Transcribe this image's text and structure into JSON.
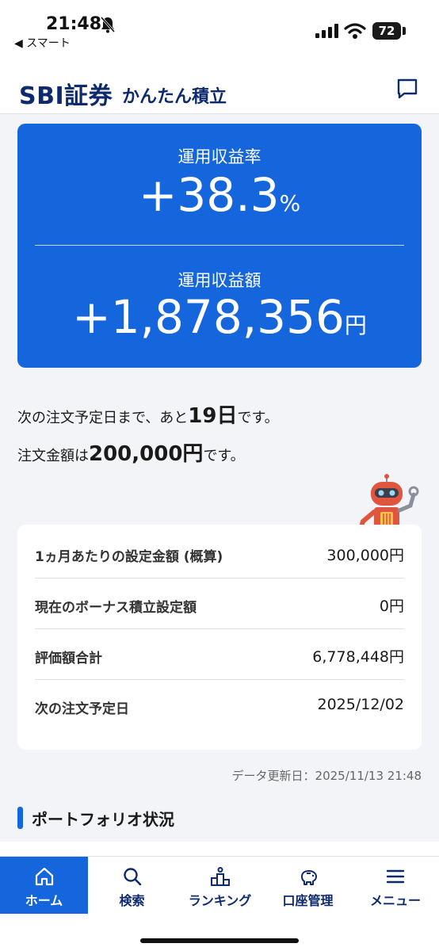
{
  "status_bar": {
    "time": "21:48",
    "back_app": "◀ スマート",
    "battery": "72"
  },
  "header": {
    "brand": "SBI証券",
    "subtitle": "かんたん積立"
  },
  "profit_card": {
    "rate_label": "運用収益率",
    "rate_value": "+38.3",
    "rate_unit": "%",
    "amount_label": "運用収益額",
    "amount_value": "+1,878,356",
    "amount_unit": "円"
  },
  "next_order": {
    "prefix": "次の注文予定日まで、あと",
    "days": "19日",
    "suffix": "です。",
    "amount_prefix": "注文金額は",
    "amount": "200,000円",
    "amount_suffix": "です。"
  },
  "settings": [
    {
      "label": "1ヵ月あたりの設定金額 (概算)",
      "value": "300,000円"
    },
    {
      "label": "現在のボーナス積立設定額",
      "value": "0円"
    },
    {
      "label": "評価額合計",
      "value": "6,778,448円"
    },
    {
      "label": "次の注文予定日",
      "value": "2025/12/02"
    }
  ],
  "update_info": "データ更新日：2025/11/13 21:48",
  "section_title": "ポートフォリオ状況",
  "bottom_nav": [
    {
      "label": "ホーム",
      "icon": "home-icon",
      "active": true
    },
    {
      "label": "検索",
      "icon": "search-icon",
      "active": false
    },
    {
      "label": "ランキング",
      "icon": "ranking-icon",
      "active": false
    },
    {
      "label": "口座管理",
      "icon": "piggy-bank-icon",
      "active": false
    },
    {
      "label": "メニュー",
      "icon": "menu-icon",
      "active": false
    }
  ],
  "colors": {
    "accent": "#1566dc",
    "brand": "#0d2a6e",
    "background": "#f2f4f8"
  }
}
